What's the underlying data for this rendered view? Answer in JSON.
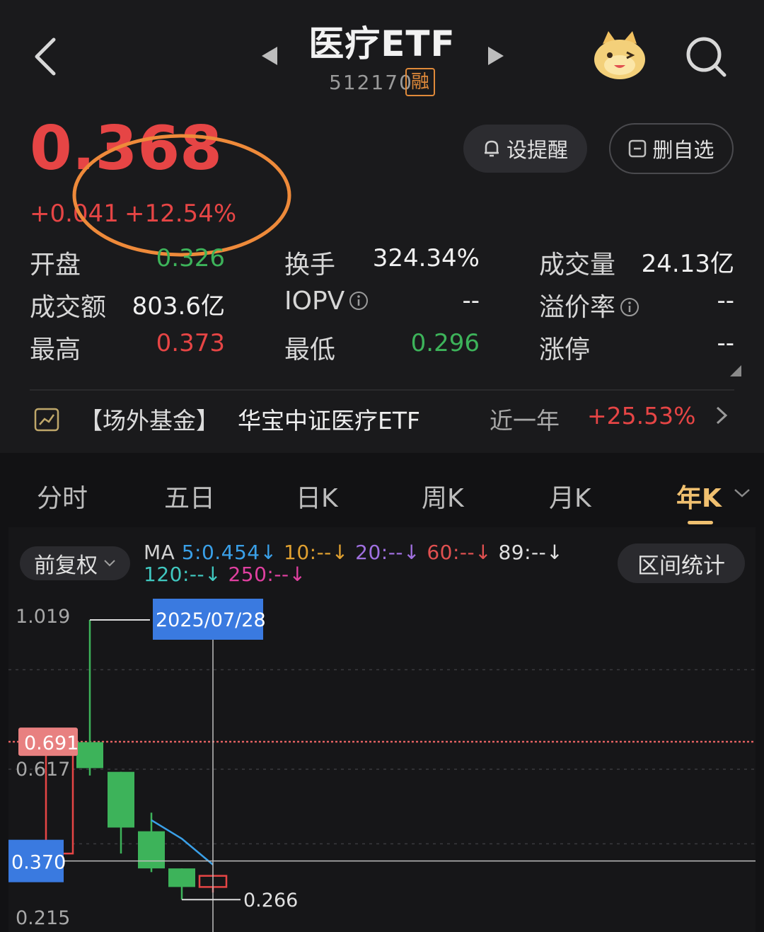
{
  "header": {
    "title": "医疗ETF",
    "code": "512170",
    "badge": "融"
  },
  "quote": {
    "price": "0.368",
    "change": "+0.041",
    "change_pct": "+12.54%",
    "remind_label": "设提醒",
    "remove_label": "删自选"
  },
  "stats": [
    {
      "label": "开盘",
      "value": "0.326",
      "color": "green"
    },
    {
      "label": "换手",
      "value": "324.34%",
      "color": "white"
    },
    {
      "label": "成交量",
      "value": "24.13亿",
      "color": "white"
    },
    {
      "label": "成交额",
      "value": "803.6亿",
      "color": "white"
    },
    {
      "label": "IOPV",
      "value": "--",
      "color": "white"
    },
    {
      "label": "溢价率",
      "value": "--",
      "color": "white"
    },
    {
      "label": "最高",
      "value": "0.373",
      "color": "red"
    },
    {
      "label": "最低",
      "value": "0.296",
      "color": "green"
    },
    {
      "label": "涨停",
      "value": "--",
      "color": "white"
    }
  ],
  "fund": {
    "tag": "【场外基金】",
    "name": "华宝中证医疗ETF",
    "period": "近一年",
    "return": "+25.53%"
  },
  "tabs": [
    "分时",
    "五日",
    "日K",
    "周K",
    "月K",
    "年K"
  ],
  "active_tab": "年K",
  "chart_controls": {
    "adjust": "前复权",
    "range_stats": "区间统计",
    "ma_prefix": "MA",
    "ma": [
      {
        "text": "5:0.454",
        "color": "#3aa0e8"
      },
      {
        "text": "10:--",
        "color": "#e0a030"
      },
      {
        "text": "20:--",
        "color": "#a070e0"
      },
      {
        "text": "60:--",
        "color": "#e05050"
      },
      {
        "text": "89:--",
        "color": "#e0e0e0"
      },
      {
        "text": "120:--",
        "color": "#40c8c0"
      },
      {
        "text": "250:--",
        "color": "#e040a0"
      }
    ]
  },
  "chart_data": {
    "type": "candlestick",
    "y_labels": [
      "1.019",
      "0.617",
      "0.215"
    ],
    "cursor_date": "2025/07/28",
    "cursor_price": "0.370",
    "ref_line_label": "0.691",
    "low_label": "0.266",
    "ylim": [
      0.215,
      1.019
    ],
    "candles": [
      {
        "open": 0.67,
        "close": 0.39,
        "high": 0.69,
        "low": 0.36,
        "color": "red"
      },
      {
        "open": 0.69,
        "close": 0.62,
        "high": 1.019,
        "low": 0.6,
        "color": "green"
      },
      {
        "open": 0.61,
        "close": 0.46,
        "high": 0.61,
        "low": 0.39,
        "color": "green"
      },
      {
        "open": 0.45,
        "close": 0.35,
        "high": 0.5,
        "low": 0.34,
        "color": "green"
      },
      {
        "open": 0.35,
        "close": 0.3,
        "high": 0.35,
        "low": 0.266,
        "color": "green"
      },
      {
        "open": 0.33,
        "close": 0.3,
        "high": 0.33,
        "low": 0.285,
        "color": "red"
      }
    ],
    "ma5": [
      null,
      null,
      null,
      0.48,
      0.43,
      0.36
    ],
    "colors": {
      "up": "#e64545",
      "down": "#3db35a",
      "ma5": "#3aa0e8",
      "cursor": "#3a7ae0"
    }
  }
}
